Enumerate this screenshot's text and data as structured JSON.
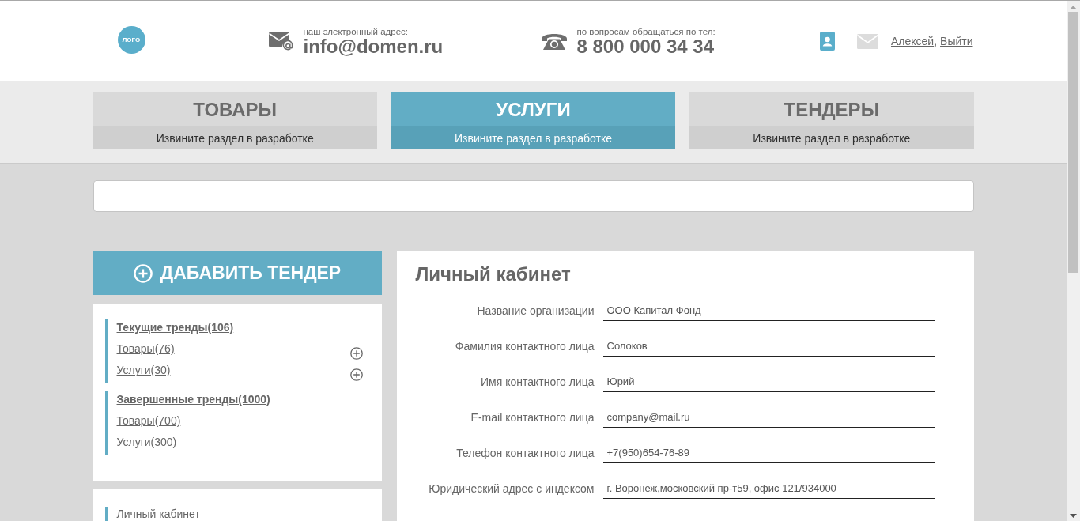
{
  "header": {
    "logo": "ЛОГО",
    "email": {
      "label": "наш электронный адрес:",
      "value": "info@domen.ru"
    },
    "phone": {
      "label": "по вопросам обращаться по тел:",
      "value": "8 800 000 34 34"
    },
    "account": {
      "user": "Алексей",
      "separator": ",",
      "logout": "Выйти"
    }
  },
  "tabs": [
    {
      "title": "ТОВАРЫ",
      "subtitle": "Извините раздел в разработке",
      "selected": false
    },
    {
      "title": "УСЛУГИ",
      "subtitle": "Извините раздел в разработке",
      "selected": true
    },
    {
      "title": "ТЕНДЕРЫ",
      "subtitle": "Извините раздел в разработке",
      "selected": false
    }
  ],
  "sidebar": {
    "add_button": "ДАБАВИТЬ ТЕНДЕР",
    "groups": [
      {
        "title": "Текущие тренды(106)",
        "children": [
          {
            "label": "Товары(76)",
            "expandable": true
          },
          {
            "label": "Услуги(30)",
            "expandable": true
          }
        ]
      },
      {
        "title": "Завершенные тренды(1000)",
        "children": [
          {
            "label": "Товары(700)",
            "expandable": false
          },
          {
            "label": "Услуги(300)",
            "expandable": false
          }
        ]
      }
    ],
    "menu": [
      {
        "label": "Личный кабинет"
      }
    ]
  },
  "profile": {
    "title": "Личный кабинет",
    "fields": [
      {
        "label": "Название организации",
        "value": "ООО Капитал Фонд"
      },
      {
        "label": "Фамилия контактного лица",
        "value": "Солоков"
      },
      {
        "label": "Имя контактного лица",
        "value": "Юрий"
      },
      {
        "label": "E-mail контактного лица",
        "value": "company@mail.ru"
      },
      {
        "label": "Телефон контактного лица",
        "value": "+7(950)654-76-89"
      },
      {
        "label": "Юридический адрес с индексом",
        "value": "г. Воронеж,московский пр-т59, офис 121/934000"
      }
    ]
  }
}
